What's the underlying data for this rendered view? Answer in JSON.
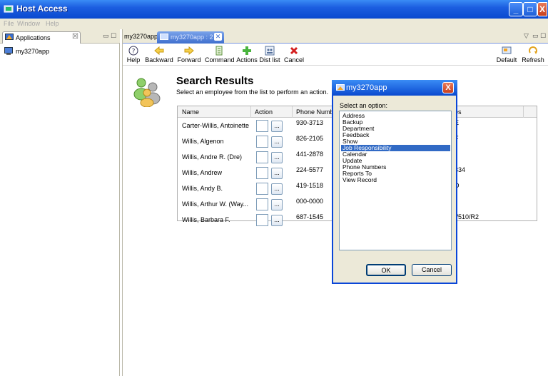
{
  "window": {
    "title": "Host Access",
    "controls": {
      "minimize": "_",
      "maximize": "□",
      "close": "X"
    }
  },
  "menu": [
    "File",
    "Window",
    "Help"
  ],
  "left_pane": {
    "tab_label": "Applications",
    "tab_close": "☒",
    "tree_items": [
      "my3270app"
    ]
  },
  "editor": {
    "tab_inactive": "my3270app",
    "tab_active": "my3270app : 2",
    "tab_close": "✕"
  },
  "toolbar": {
    "help": "Help",
    "backward": "Backward",
    "forward": "Forward",
    "command": "Command",
    "actions": "Actions",
    "dist_list": "Dist list",
    "cancel": "Cancel",
    "default": "Default",
    "refresh": "Refresh"
  },
  "results": {
    "title": "Search Results",
    "subtitle": "Select an employee from the list to perform an action.",
    "columns": [
      "Name",
      "Action",
      "Phone Numb",
      "es"
    ],
    "rows": [
      {
        "name": "Carter-Willis, Antoinette",
        "phone": "930-3713",
        "extra": "E"
      },
      {
        "name": "Willis, Algenon",
        "phone": "826-2105",
        "extra": "F"
      },
      {
        "name": "Willis, Andre R. (Dre)",
        "phone": "441-2878",
        "extra": ""
      },
      {
        "name": "Willis, Andrew",
        "phone": "224-5577",
        "extra": "334"
      },
      {
        "name": "Willis, Andy B.",
        "phone": "419-1518",
        "extra": "D"
      },
      {
        "name": "Willis, Arthur W. (Way...",
        "phone": "000-0000",
        "extra": ""
      },
      {
        "name": "Willis, Barbara F.",
        "phone": "687-1545",
        "extra": "\\/510/R2"
      }
    ],
    "dots_label": "..."
  },
  "dialog": {
    "title": "my3270app",
    "close": "X",
    "prompt": "Select an option:",
    "options": [
      "Address",
      "Backup",
      "Department",
      "Feedback",
      "Show",
      "Job Responsibility",
      "Calendar",
      "Update",
      "Phone Numbers",
      "Reports To",
      "View Record"
    ],
    "selected": "Job Responsibility",
    "ok": "OK",
    "cancel": "Cancel"
  },
  "colors": {
    "titlebar": "#0a49cf",
    "selection": "#316ac5",
    "chrome": "#ece9d8"
  }
}
